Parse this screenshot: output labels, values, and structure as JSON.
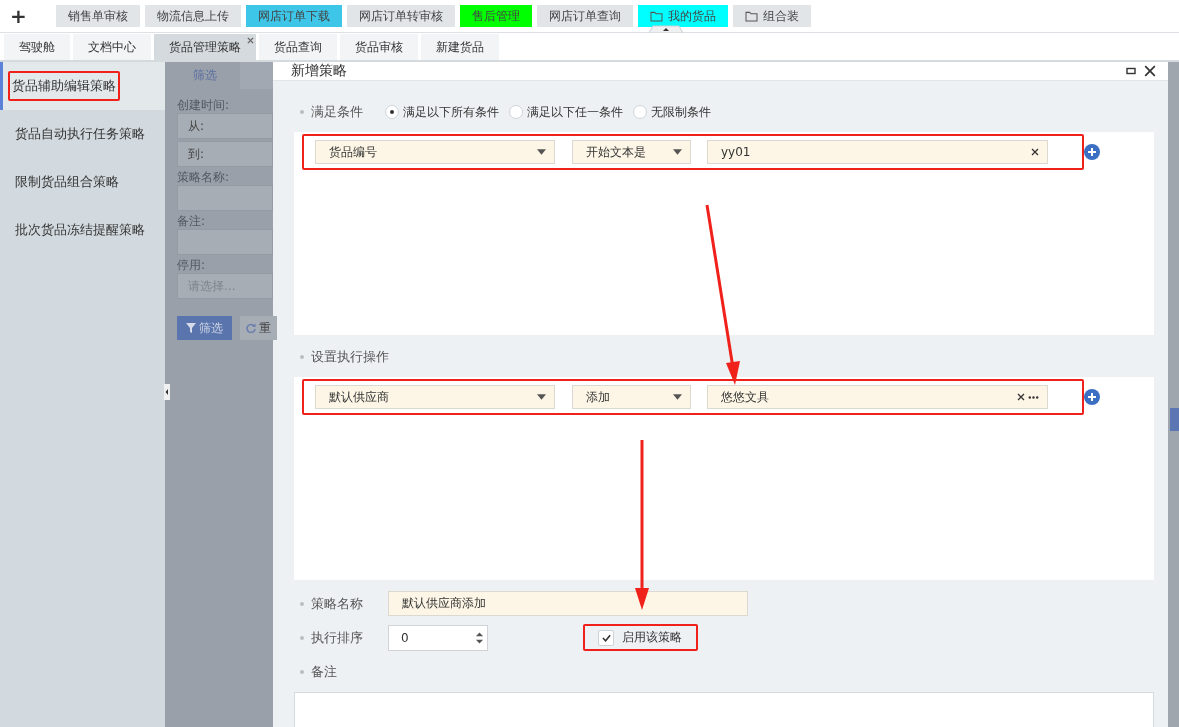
{
  "top_bar": {
    "add_label": "+",
    "quick_tabs": [
      {
        "label": "销售单审核",
        "color": "#e1e5e8",
        "folder": false
      },
      {
        "label": "物流信息上传",
        "color": "#e1e5e8",
        "folder": false
      },
      {
        "label": "网店订单下载",
        "color": "#3ec6e8",
        "folder": false
      },
      {
        "label": "网店订单转审核",
        "color": "#e1e5e8",
        "folder": false
      },
      {
        "label": "售后管理",
        "color": "#00ff00",
        "folder": false
      },
      {
        "label": "网店订单查询",
        "color": "#e1e5e8",
        "folder": false
      },
      {
        "label": "我的货品",
        "color": "#00ffff",
        "folder": true
      },
      {
        "label": "组合装",
        "color": "#e1e5e8",
        "folder": true
      }
    ]
  },
  "doc_tabs": [
    {
      "label": "驾驶舱",
      "selected": false,
      "closable": false
    },
    {
      "label": "文档中心",
      "selected": false,
      "closable": false
    },
    {
      "label": "货品管理策略",
      "selected": true,
      "closable": true
    },
    {
      "label": "货品查询",
      "selected": false,
      "closable": false
    },
    {
      "label": "货品审核",
      "selected": false,
      "closable": false
    },
    {
      "label": "新建货品",
      "selected": false,
      "closable": false
    }
  ],
  "sidebar": {
    "items": [
      {
        "label": "货品辅助编辑策略",
        "selected": true,
        "highlighted": true
      },
      {
        "label": "货品自动执行任务策略",
        "selected": false,
        "highlighted": false
      },
      {
        "label": "限制货品组合策略",
        "selected": false,
        "highlighted": false
      },
      {
        "label": "批次货品冻结提醒策略",
        "selected": false,
        "highlighted": false
      }
    ]
  },
  "filter_panel": {
    "tab": "筛选",
    "created_label": "创建时间:",
    "from_label": "从:",
    "to_label": "到:",
    "name_label": "策略名称:",
    "remark_label": "备注:",
    "disabled_label": "停用:",
    "disabled_placeholder": "请选择...",
    "filter_button": "筛选",
    "reset_button": "重"
  },
  "dialog": {
    "title": "新增策略",
    "conditions": {
      "label": "满足条件",
      "radios": [
        {
          "label": "满足以下所有条件",
          "selected": true
        },
        {
          "label": "满足以下任一条件",
          "selected": false
        },
        {
          "label": "无限制条件",
          "selected": false
        }
      ],
      "rows": [
        {
          "field": "货品编号",
          "operator": "开始文本是",
          "value": "yy01",
          "more": false,
          "highlighted": true
        }
      ]
    },
    "actions": {
      "label": "设置执行操作",
      "rows": [
        {
          "field": "默认供应商",
          "operator": "添加",
          "value": "悠悠文具",
          "more": true,
          "highlighted": true
        }
      ]
    },
    "name_label": "策略名称",
    "name_value": "默认供应商添加",
    "order_label": "执行排序",
    "order_value": "0",
    "enable": {
      "label": "启用该策略",
      "checked": true,
      "highlighted": true
    },
    "remark_label": "备注"
  }
}
